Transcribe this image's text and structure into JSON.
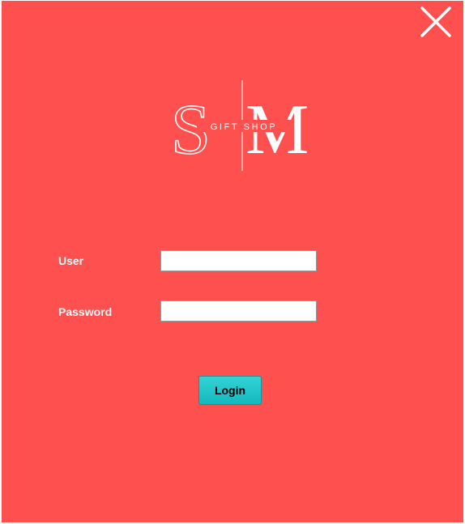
{
  "colors": {
    "window_background": "#ff5050",
    "login_button": "#1fc5c9",
    "label_text": "#ffffff"
  },
  "window": {
    "close_icon": "close-x-icon"
  },
  "logo": {
    "initials": "SM",
    "tagline": "GIFT SHOP"
  },
  "form": {
    "user_label": "User",
    "user_value": "",
    "password_label": "Password",
    "password_value": "",
    "login_label": "Login"
  }
}
